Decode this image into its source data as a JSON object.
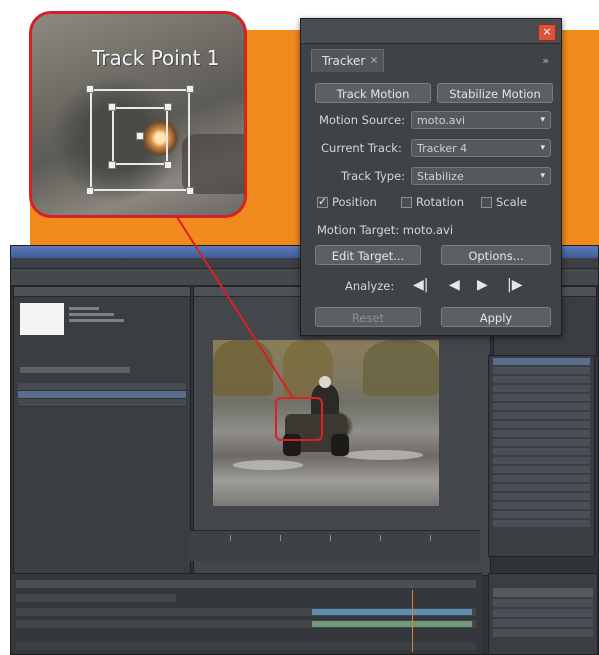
{
  "callout": {
    "track_point_label": "Track Point 1"
  },
  "tracker_panel": {
    "tab_label": "Tracker",
    "close_glyph": "×",
    "tab_close_glyph": "×",
    "panel_menu_glyph": "»",
    "buttons": {
      "track_motion": "Track Motion",
      "stabilize_motion": "Stabilize Motion",
      "edit_target": "Edit Target...",
      "options": "Options...",
      "reset": "Reset",
      "apply": "Apply"
    },
    "motion_source": {
      "label": "Motion Source:",
      "value": "moto.avi"
    },
    "current_track": {
      "label": "Current Track:",
      "value": "Tracker 4"
    },
    "track_type": {
      "label": "Track Type:",
      "value": "Stabilize"
    },
    "checkboxes": [
      {
        "label": "Position",
        "checked": true
      },
      {
        "label": "Rotation",
        "checked": false
      },
      {
        "label": "Scale",
        "checked": false
      }
    ],
    "motion_target_label": "Motion Target: moto.avi",
    "analyze_label": "Analyze:",
    "transport_glyphs": {
      "step_back": "◀|",
      "play_back": "◀",
      "play_forward": "▶",
      "step_forward": "|▶"
    },
    "caret_glyph": "▾",
    "check_glyph": "✓"
  },
  "colors": {
    "accent_orange": "#f08a1c",
    "callout_red": "#d62027",
    "panel_bg": "#3f4246"
  },
  "icons": [
    "close-icon",
    "panel-menu-icon",
    "dropdown-caret-icon",
    "step-back-icon",
    "play-back-icon",
    "play-forward-icon",
    "step-forward-icon"
  ]
}
